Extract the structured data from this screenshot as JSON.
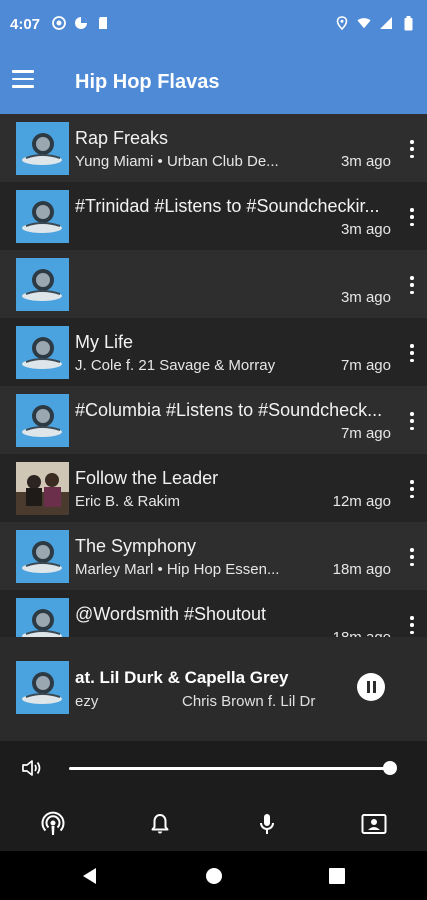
{
  "status_bar": {
    "time": "4:07",
    "left_icons": [
      "record-icon",
      "data-saver-icon",
      "sd-card-icon"
    ],
    "right_icons": [
      "location-icon",
      "wifi-icon",
      "signal-icon",
      "battery-icon"
    ]
  },
  "app_bar": {
    "menu_icon": "hamburger-menu-icon",
    "title": "Hip Hop Flavas",
    "color": "#4f8ad6"
  },
  "feed": {
    "items": [
      {
        "title": "Rap Freaks",
        "subtitle": "Yung Miami • Urban Club De...",
        "time": "3m ago",
        "thumb": "station-logo"
      },
      {
        "title": "#Trinidad #Listens to #Soundcheckir...",
        "subtitle": "",
        "time": "3m ago",
        "thumb": "station-logo"
      },
      {
        "title": "",
        "subtitle": "",
        "time": "3m ago",
        "thumb": "station-logo"
      },
      {
        "title": "My Life",
        "subtitle": "J. Cole f. 21 Savage & Morray",
        "time": "7m ago",
        "thumb": "station-logo"
      },
      {
        "title": "#Columbia #Listens to #Soundcheck...",
        "subtitle": "",
        "time": "7m ago",
        "thumb": "station-logo"
      },
      {
        "title": "Follow the Leader",
        "subtitle": "Eric B. & Rakim",
        "time": "12m ago",
        "thumb": "album-art"
      },
      {
        "title": "The Symphony",
        "subtitle": "Marley Marl • Hip Hop Essen...",
        "time": "18m ago",
        "thumb": "station-logo"
      },
      {
        "title": "@Wordsmith #Shoutout",
        "subtitle": "",
        "time": "18m ago",
        "thumb": "station-logo"
      }
    ]
  },
  "now_playing": {
    "title": "at. Lil Durk & Capella Grey",
    "sub_left": "ezy",
    "sub_right": "Chris Brown f. Lil Dr",
    "control": "pause-icon"
  },
  "volume": {
    "level": 1.0,
    "icon": "volume-icon"
  },
  "bottom_nav": {
    "items": [
      "podcast-icon",
      "bell-icon",
      "microphone-icon",
      "contact-card-icon"
    ]
  },
  "system_nav": {
    "items": [
      "back-icon",
      "home-icon",
      "recents-icon"
    ]
  }
}
